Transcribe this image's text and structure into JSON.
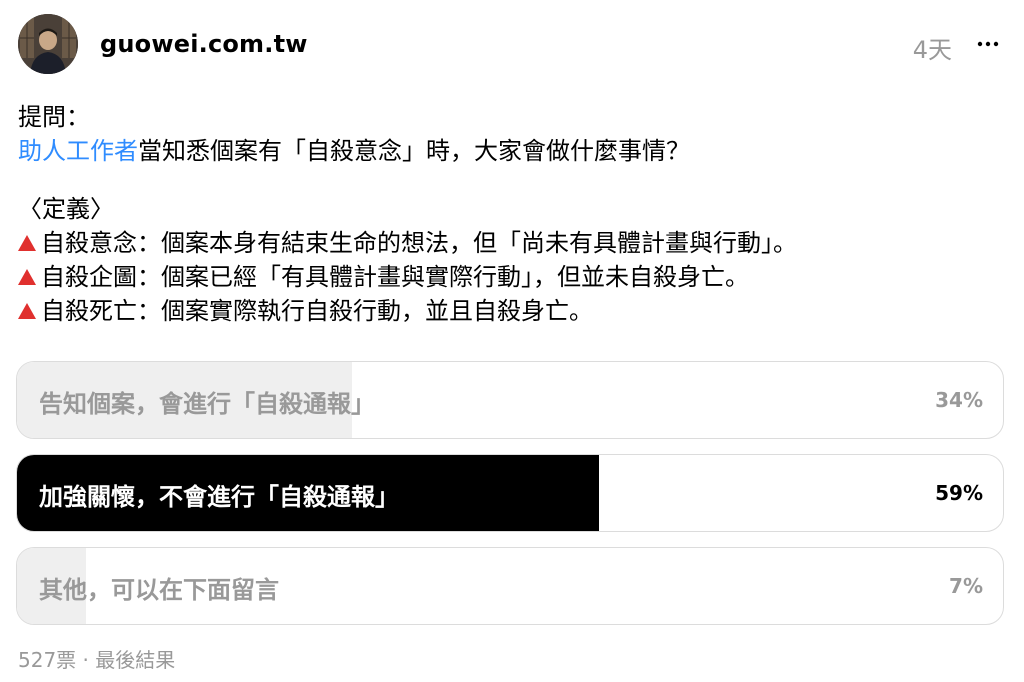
{
  "header": {
    "username": "guowei.com.tw",
    "timestamp": "4天",
    "more_icon": "more-horizontal-icon"
  },
  "post": {
    "question_prefix": "提問：",
    "mention": "助人工作者",
    "question_rest": "當知悉個案有「自殺意念」時，大家會做什麼事情？",
    "definition_heading": "〈定義〉",
    "definitions": [
      {
        "icon": "red-triangle-icon",
        "text": "自殺意念：個案本身有結束生命的想法，但「尚未有具體計畫與行動」。"
      },
      {
        "icon": "red-triangle-icon",
        "text": "自殺企圖：個案已經「有具體計畫與實際行動」，但並未自殺身亡。"
      },
      {
        "icon": "red-triangle-icon",
        "text": "自殺死亡：個案實際執行自殺行動，並且自殺身亡。"
      }
    ]
  },
  "poll": {
    "options": [
      {
        "label": "告知個案，會進行「自殺通報」",
        "percent_text": "34%",
        "percent_value": 34,
        "selected": false
      },
      {
        "label": "加強關懷，不會進行「自殺通報」",
        "percent_text": "59%",
        "percent_value": 59,
        "selected": true
      },
      {
        "label": "其他，可以在下面留言",
        "percent_text": "7%",
        "percent_value": 7,
        "selected": false
      }
    ]
  },
  "footer": {
    "votes": "527票",
    "separator": "·",
    "status": "最後結果"
  },
  "colors": {
    "mention": "#2f8cff",
    "triangle": "#e0302e",
    "muted": "#999999",
    "selected_fill": "#000000",
    "unselected_fill": "#efefef"
  }
}
